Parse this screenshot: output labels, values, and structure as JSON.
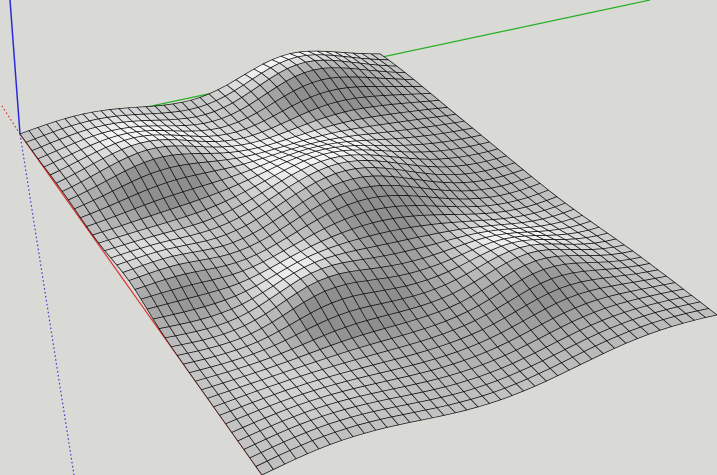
{
  "viewport": {
    "background_color": "#d9d9d6"
  },
  "axes": {
    "red_axis_color": "#e03030",
    "green_axis_color": "#22b022",
    "blue_axis_color": "#2a2ad8",
    "blue_axis_dotted_color": "#3a3ad0",
    "red_axis_dotted_color": "#cc3030"
  },
  "terrain_mesh": {
    "line_color": "#111111",
    "fill_color": "#f4f4f4",
    "shade_color": "#8f8f8f",
    "grid_columns": 40,
    "grid_rows": 40
  }
}
